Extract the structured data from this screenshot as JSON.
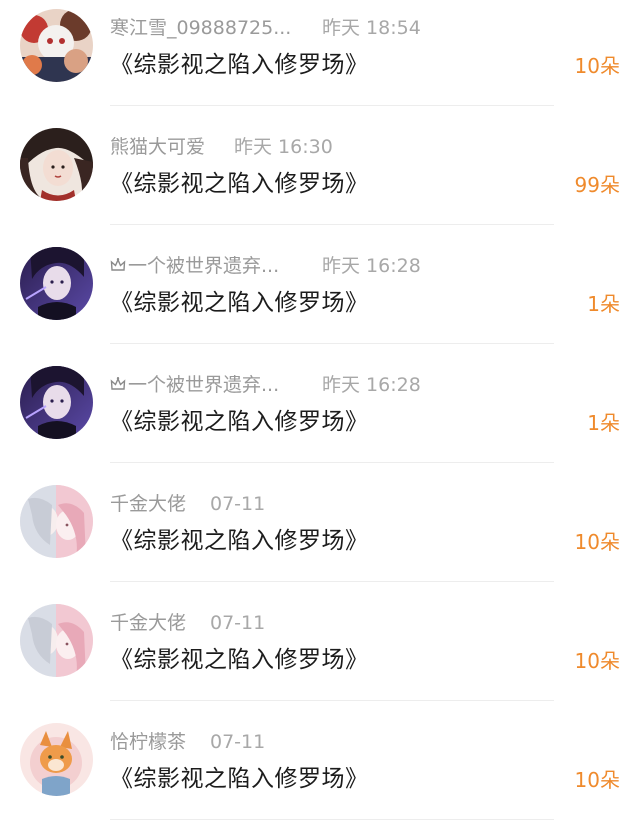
{
  "gifts": [
    {
      "name": "寒江雪_09888725...",
      "time": "昨天 18:54",
      "title": "《综影视之陷入修罗场》",
      "amount": "10朵",
      "crown": false,
      "avatar": "anime-group"
    },
    {
      "name": "熊猫大可爱",
      "time": "昨天 16:30",
      "title": "《综影视之陷入修罗场》",
      "amount": "99朵",
      "crown": false,
      "avatar": "dark-hair-girl"
    },
    {
      "name": "一个被世界遗弃...",
      "time": "昨天 16:28",
      "title": "《综影视之陷入修罗场》",
      "amount": "1朵",
      "crown": true,
      "avatar": "purple-boy"
    },
    {
      "name": "一个被世界遗弃...",
      "time": "昨天 16:28",
      "title": "《综影视之陷入修罗场》",
      "amount": "1朵",
      "crown": true,
      "avatar": "purple-boy"
    },
    {
      "name": "千金大佬",
      "time": "07-11",
      "title": "《综影视之陷入修罗场》",
      "amount": "10朵",
      "crown": false,
      "avatar": "pastel-couple"
    },
    {
      "name": "千金大佬",
      "time": "07-11",
      "title": "《综影视之陷入修罗场》",
      "amount": "10朵",
      "crown": false,
      "avatar": "pastel-couple"
    },
    {
      "name": "恰柠檬茶",
      "time": "07-11",
      "title": "《综影视之陷入修罗场》",
      "amount": "10朵",
      "crown": false,
      "avatar": "fox-cartoon"
    }
  ],
  "colors": {
    "amount": "#ef8a2c",
    "meta": "#9a9a9a",
    "title": "#1c1c1c",
    "divider": "#ededed"
  }
}
